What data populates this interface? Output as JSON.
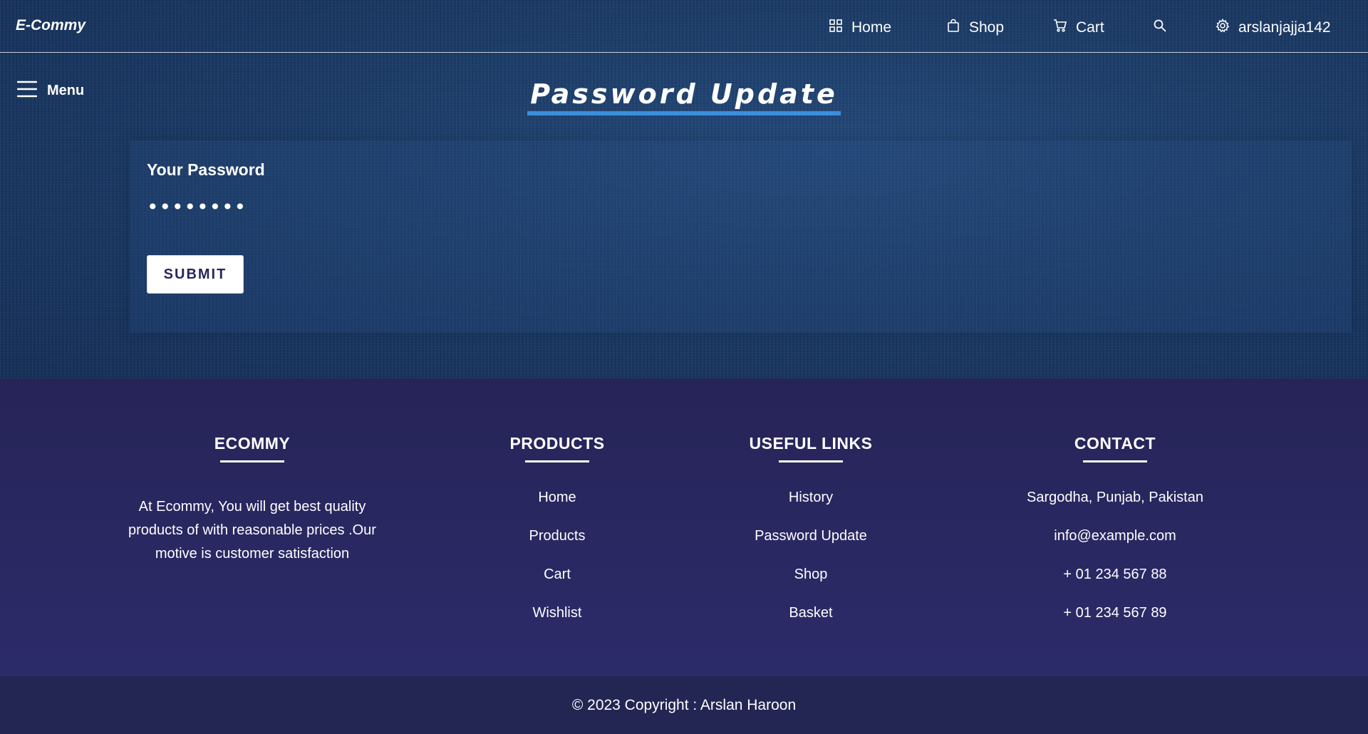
{
  "nav": {
    "brand": "E-Commy",
    "items": [
      {
        "label": "Home",
        "icon": "grid-icon"
      },
      {
        "label": "Shop",
        "icon": "shopping-bag-icon"
      },
      {
        "label": "Cart",
        "icon": "cart-icon"
      }
    ],
    "search_icon": "search-icon",
    "user": {
      "label": "arslanjajja142",
      "icon": "gear-icon"
    }
  },
  "menu": {
    "label": "Menu",
    "icon": "hamburger-icon"
  },
  "page": {
    "title": "Password Update"
  },
  "form": {
    "label": "Your Password",
    "password_value": "••••••••",
    "submit_label": "SUBMIT"
  },
  "footer": {
    "ecommy": {
      "heading": "ECOMMY",
      "text": "At Ecommy, You will get best quality products of with reasonable prices .Our motive is customer satisfaction"
    },
    "products": {
      "heading": "PRODUCTS",
      "links": [
        "Home",
        "Products",
        "Cart",
        "Wishlist"
      ]
    },
    "useful_links": {
      "heading": "USEFUL LINKS",
      "links": [
        "History",
        "Password Update",
        "Shop",
        "Basket"
      ]
    },
    "contact": {
      "heading": "CONTACT",
      "lines": [
        "Sargodha, Punjab, Pakistan",
        "info@example.com",
        "+ 01 234 567 88",
        "+ 01 234 567 89"
      ]
    }
  },
  "copyright": "© 2023 Copyright : Arslan Haroon",
  "colors": {
    "hero_bg": "#1c3c68",
    "title_underline": "#3a8fdc",
    "footer_bg": "#2c2b6a",
    "copyright_bg": "#232653",
    "button_text": "#27275a"
  }
}
